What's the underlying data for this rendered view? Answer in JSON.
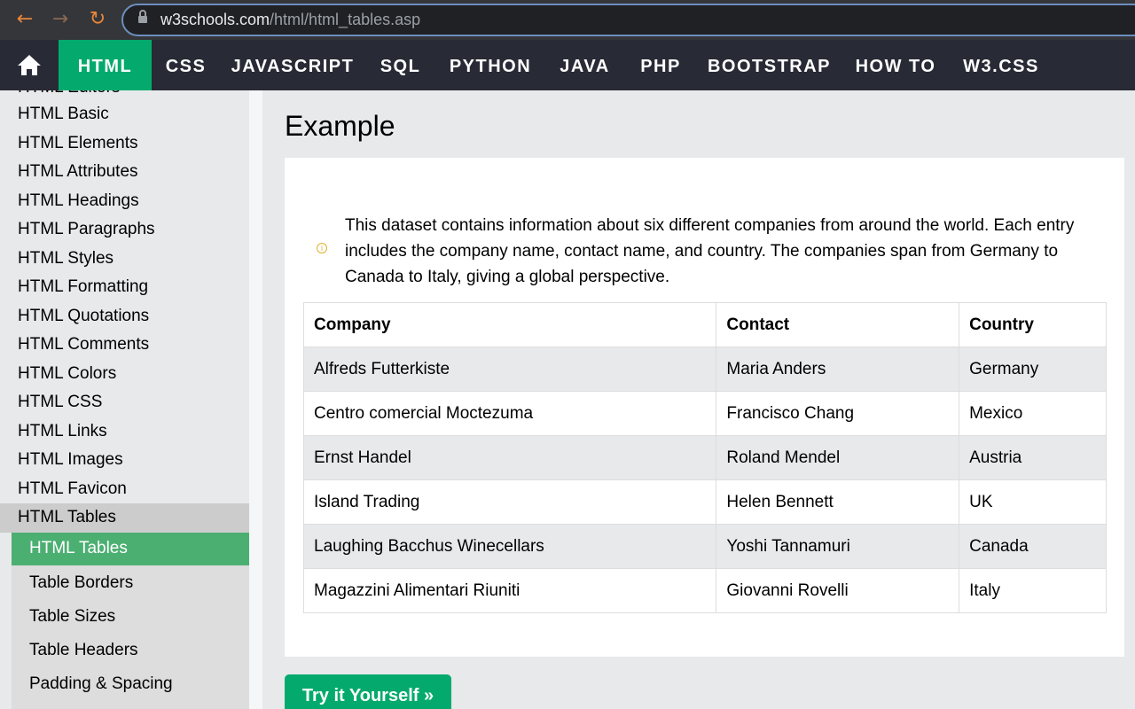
{
  "browser": {
    "back_icon": "←",
    "forward_icon": "→",
    "reload_icon": "↻",
    "url_host": "w3schools.com",
    "url_path": "/html/html_tables.asp"
  },
  "topnav": {
    "items": [
      "HTML",
      "CSS",
      "JAVASCRIPT",
      "SQL",
      "PYTHON",
      "JAVA",
      "PHP",
      "BOOTSTRAP",
      "HOW TO",
      "W3.CSS"
    ],
    "active": "HTML",
    "accent": "#04aa6d"
  },
  "sidebar": {
    "partial_item": "HTML Editors",
    "items": [
      "HTML Basic",
      "HTML Elements",
      "HTML Attributes",
      "HTML Headings",
      "HTML Paragraphs",
      "HTML Styles",
      "HTML Formatting",
      "HTML Quotations",
      "HTML Comments",
      "HTML Colors",
      "HTML CSS",
      "HTML Links",
      "HTML Images",
      "HTML Favicon"
    ],
    "section": "HTML Tables",
    "sub_items": [
      "HTML Tables",
      "Table Borders",
      "Table Sizes",
      "Table Headers",
      "Padding & Spacing"
    ]
  },
  "main": {
    "heading": "Example",
    "description": "This dataset contains information about six different companies from around the world. Each entry includes the company name, contact name, and country. The companies span from Germany to Canada to Italy, giving a global perspective.",
    "table": {
      "headers": [
        "Company",
        "Contact",
        "Country"
      ],
      "rows": [
        [
          "Alfreds Futterkiste",
          "Maria Anders",
          "Germany"
        ],
        [
          "Centro comercial Moctezuma",
          "Francisco Chang",
          "Mexico"
        ],
        [
          "Ernst Handel",
          "Roland Mendel",
          "Austria"
        ],
        [
          "Island Trading",
          "Helen Bennett",
          "UK"
        ],
        [
          "Laughing Bacchus Winecellars",
          "Yoshi Tannamuri",
          "Canada"
        ],
        [
          "Magazzini Alimentari Riuniti",
          "Giovanni Rovelli",
          "Italy"
        ]
      ]
    },
    "try_button": "Try it Yourself »"
  }
}
